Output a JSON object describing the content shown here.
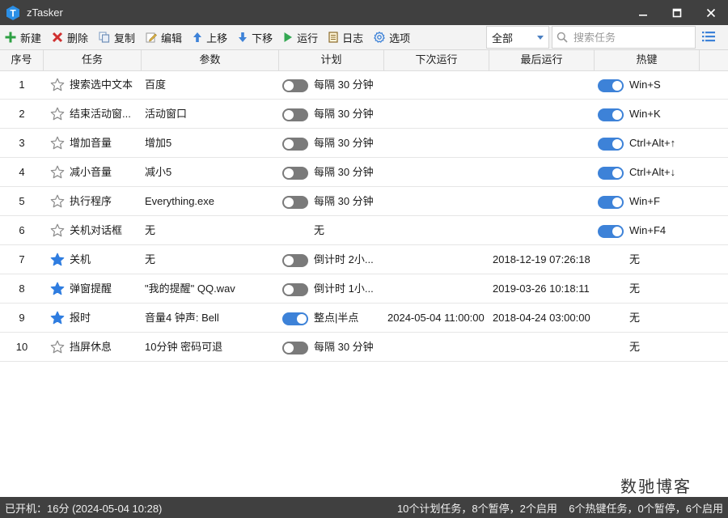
{
  "window": {
    "title": "zTasker"
  },
  "toolbar": {
    "buttons": [
      {
        "label": "新建",
        "icon": "plus-icon",
        "color": "#2ea043"
      },
      {
        "label": "删除",
        "icon": "delete-x-icon",
        "color": "#d03030"
      },
      {
        "label": "复制",
        "icon": "copy-icon",
        "color": "#6f8fb8"
      },
      {
        "label": "编辑",
        "icon": "edit-icon",
        "color": "#c9a640"
      },
      {
        "label": "上移",
        "icon": "arrow-up-icon",
        "color": "#3d82d8"
      },
      {
        "label": "下移",
        "icon": "arrow-down-icon",
        "color": "#3d82d8"
      },
      {
        "label": "运行",
        "icon": "play-icon",
        "color": "#34a853"
      },
      {
        "label": "日志",
        "icon": "log-icon",
        "color": "#c99a3c"
      },
      {
        "label": "选项",
        "icon": "gear-icon",
        "color": "#3d82d8"
      }
    ],
    "filter_value": "全部",
    "search_placeholder": "搜索任务"
  },
  "table": {
    "columns": [
      "序号",
      "任务",
      "参数",
      "计划",
      "下次运行",
      "最后运行",
      "热键"
    ],
    "rows": [
      {
        "index": "1",
        "starred": false,
        "task": "搜索选中文本",
        "param": "百度",
        "schedule_on": false,
        "schedule": "每隔 30 分钟",
        "next_run": "",
        "last_run": "",
        "hotkey_on": true,
        "hotkey": "Win+S"
      },
      {
        "index": "2",
        "starred": false,
        "task": "结束活动窗...",
        "param": "活动窗口",
        "schedule_on": false,
        "schedule": "每隔 30 分钟",
        "next_run": "",
        "last_run": "",
        "hotkey_on": true,
        "hotkey": "Win+K"
      },
      {
        "index": "3",
        "starred": false,
        "task": "增加音量",
        "param": "增加5",
        "schedule_on": false,
        "schedule": "每隔 30 分钟",
        "next_run": "",
        "last_run": "",
        "hotkey_on": true,
        "hotkey": "Ctrl+Alt+↑"
      },
      {
        "index": "4",
        "starred": false,
        "task": "减小音量",
        "param": "减小5",
        "schedule_on": false,
        "schedule": "每隔 30 分钟",
        "next_run": "",
        "last_run": "",
        "hotkey_on": true,
        "hotkey": "Ctrl+Alt+↓"
      },
      {
        "index": "5",
        "starred": false,
        "task": "执行程序",
        "param": "Everything.exe",
        "schedule_on": false,
        "schedule": "每隔 30 分钟",
        "next_run": "",
        "last_run": "",
        "hotkey_on": true,
        "hotkey": "Win+F"
      },
      {
        "index": "6",
        "starred": false,
        "task": "关机对话框",
        "param": "无",
        "schedule_on": null,
        "schedule": "无",
        "next_run": "",
        "last_run": "",
        "hotkey_on": true,
        "hotkey": "Win+F4"
      },
      {
        "index": "7",
        "starred": true,
        "task": "关机",
        "param": "无",
        "schedule_on": false,
        "schedule": "倒计时 2小...",
        "next_run": "",
        "last_run": "2018-12-19 07:26:18",
        "hotkey_on": null,
        "hotkey": "无"
      },
      {
        "index": "8",
        "starred": true,
        "task": "弹窗提醒",
        "param": "\"我的提醒\" QQ.wav",
        "schedule_on": false,
        "schedule": "倒计时 1小...",
        "next_run": "",
        "last_run": "2019-03-26 10:18:11",
        "hotkey_on": null,
        "hotkey": "无"
      },
      {
        "index": "9",
        "starred": true,
        "task": "报时",
        "param": "音量4 钟声: Bell",
        "schedule_on": true,
        "schedule": "整点|半点",
        "next_run": "2024-05-04 11:00:00",
        "last_run": "2018-04-24 03:00:00",
        "hotkey_on": null,
        "hotkey": "无"
      },
      {
        "index": "10",
        "starred": false,
        "task": "挡屏休息",
        "param": "10分钟 密码可退",
        "schedule_on": false,
        "schedule": "每隔 30 分钟",
        "next_run": "",
        "last_run": "",
        "hotkey_on": null,
        "hotkey": "无"
      }
    ]
  },
  "watermark": "数驰博客",
  "statusbar": {
    "left": "已开机：16分 (2024-05-04 10:28)",
    "right": "10个计划任务，8个暂停，2个启用    6个热键任务，0个暂停，6个启用"
  },
  "colors": {
    "titlebar": "#404040",
    "accent": "#3d82d8",
    "toggle_off": "#7a7a7a",
    "star_filled": "#2f7de0"
  }
}
